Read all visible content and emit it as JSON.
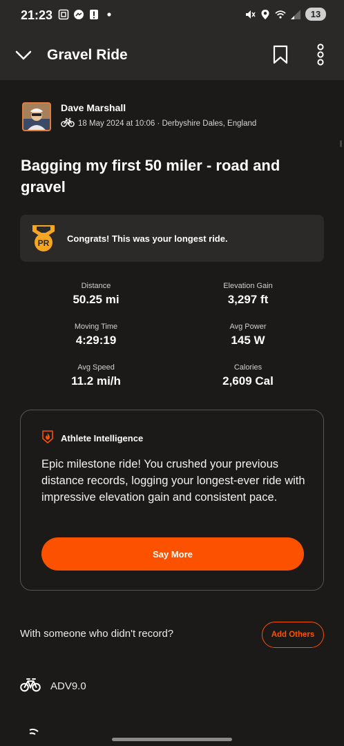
{
  "status_bar": {
    "time": "21:23",
    "left_icons": [
      "screenshot-icon",
      "messenger-icon",
      "alert-icon",
      "dot-icon"
    ],
    "right_icons": [
      "mute-icon",
      "location-icon",
      "wifi-icon",
      "signal-icon"
    ],
    "battery": "13"
  },
  "app_bar": {
    "title": "Gravel Ride",
    "icons": [
      "chevron-down-icon",
      "bookmark-icon",
      "more-vertical-icon"
    ]
  },
  "athlete": {
    "name": "Dave Marshall",
    "meta": "18 May 2024 at 10:06 · Derbyshire Dales, England",
    "sport_icon": "bike-icon"
  },
  "activity": {
    "title": "Bagging my first 50 miler - road and gravel"
  },
  "pr_card": {
    "badge": "PR",
    "text": "Congrats! This was your longest ride."
  },
  "stats": [
    {
      "label": "Distance",
      "value": "50.25 mi"
    },
    {
      "label": "Elevation Gain",
      "value": "3,297 ft"
    },
    {
      "label": "Moving Time",
      "value": "4:29:19"
    },
    {
      "label": "Avg Power",
      "value": "145 W"
    },
    {
      "label": "Avg Speed",
      "value": "11.2 mi/h"
    },
    {
      "label": "Calories",
      "value": "2,609 Cal"
    }
  ],
  "athlete_intelligence": {
    "title": "Athlete Intelligence",
    "body": "Epic milestone ride! You crushed your previous distance records, logging your longest-ever ride with impressive elevation gain and consistent pace.",
    "button": "Say More"
  },
  "with_someone": {
    "text": "With someone who didn't record?",
    "button": "Add Others"
  },
  "gear": {
    "name": "ADV9.0"
  },
  "colors": {
    "accent": "#fc5200",
    "background": "#1b1a19",
    "card": "#2b2a29",
    "medal": "#f5a623"
  }
}
